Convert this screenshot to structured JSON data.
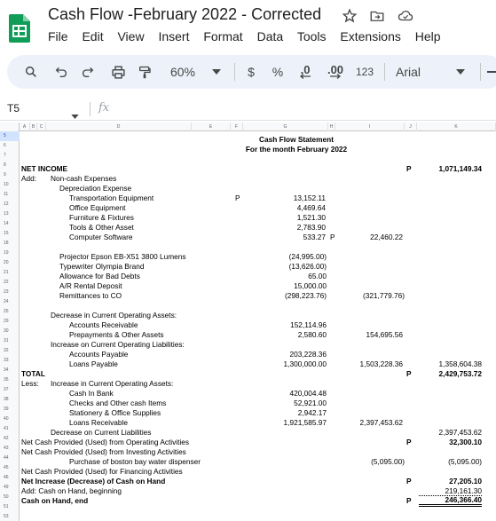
{
  "app": {
    "title": "Cash Flow -February 2022 - Corrected",
    "menu": [
      "File",
      "Edit",
      "View",
      "Insert",
      "Format",
      "Data",
      "Tools",
      "Extensions",
      "Help"
    ]
  },
  "toolbar": {
    "zoom": "60%",
    "currency": "$",
    "percent": "%",
    "dec_decrease": ".0",
    "dec_increase": ".00",
    "number_format": "123",
    "font": "Arial"
  },
  "formula_bar": {
    "cell_ref": "T5",
    "fx": "fx",
    "value": ""
  },
  "columns": [
    "A",
    "B",
    "C",
    "D",
    "E",
    "F",
    "G",
    "H",
    "I",
    "J",
    "K"
  ],
  "rows": [
    "5",
    "6",
    "7",
    "8",
    "9",
    "10",
    "11",
    "12",
    "13",
    "14",
    "15",
    "18",
    "19",
    "20",
    "21",
    "22",
    "23",
    "24",
    "25",
    "29",
    "30",
    "31",
    "32",
    "33",
    "34",
    "35",
    "37",
    "38",
    "39",
    "40",
    "41",
    "42",
    "43",
    "44",
    "45",
    "46",
    "49",
    "50",
    "51",
    "53"
  ],
  "sheet": {
    "title": "Cash Flow Statement",
    "subtitle": "For the month February 2022",
    "net_income_label": "NET INCOME",
    "net_income_p": "P",
    "net_income_value": "1,071,149.34",
    "add_label": "Add:",
    "noncash_label": "Non-cash Expenses",
    "depreciation_label": "Depreciation Expense",
    "dep_items": [
      {
        "label": "Transportation Equipment",
        "p": "P",
        "value": "13,152.11"
      },
      {
        "label": "Office Equipment",
        "p": "",
        "value": "4,469.64"
      },
      {
        "label": "Furniture & Fixtures",
        "p": "",
        "value": "1,521.30"
      },
      {
        "label": "Tools & Other Asset",
        "p": "",
        "value": "2,783.90"
      },
      {
        "label": "Computer Software",
        "p": "",
        "value": "533.27"
      }
    ],
    "dep_total_p": "P",
    "dep_total": "22,460.22",
    "other_items": [
      {
        "label": "Projector Epson EB-X51 3800 Lumens",
        "value": "(24,995.00)"
      },
      {
        "label": "Typewriter Olympia Brand",
        "value": "(13,626.00)"
      },
      {
        "label": "Allowance for Bad Debts",
        "value": "65.00"
      },
      {
        "label": "A/R Rental Deposit",
        "value": "15,000.00"
      },
      {
        "label": "Remittances to CO",
        "value": "(298,223.76)"
      }
    ],
    "other_total": "(321,779.76)",
    "dec_current_assets_label": "Decrease in Current Operating Assets:",
    "dec_items": [
      {
        "label": "Accounts Receivable",
        "value": "152,114.96"
      },
      {
        "label": "Prepayments & Other Assets",
        "value": "2,580.60"
      }
    ],
    "dec_total": "154,695.56",
    "inc_liab_label": "Increase on Current Operating Liabilities:",
    "inc_liab_items": [
      {
        "label": "Accounts Payable",
        "value": "203,228.36"
      },
      {
        "label": "Loans Payable",
        "value": "1,300,000.00"
      }
    ],
    "inc_liab_total": "1,503,228.36",
    "inc_liab_total_k": "1,358,604.38",
    "total_label": "TOTAL",
    "total_p": "P",
    "total_value": "2,429,753.72",
    "less_label": "Less:",
    "inc_current_assets_label": "Increase in Current Operating Assets:",
    "inc_items": [
      {
        "label": "Cash In Bank",
        "value": "420,004.48"
      },
      {
        "label": "Checks and Other cash Items",
        "value": "52,921.00"
      },
      {
        "label": "Stationery & Office Supplies",
        "value": "2,942.17"
      },
      {
        "label": "Loans Receivable",
        "value": "1,921,585.97"
      }
    ],
    "inc_total": "2,397,453.62",
    "dec_liab_label": "Decrease on Current Liabilities",
    "dec_liab_value": "2,397,453.62",
    "op_label": "Net Cash Provided (Used) from Operating Activities",
    "op_p": "P",
    "op_value": "32,300.10",
    "inv_label": "Net Cash Provided (Used) from Investing Activities",
    "purchase_label": "Purchase of boston bay water dispenser",
    "purchase_value": "(5,095.00)",
    "purchase_k": "(5,095.00)",
    "fin_label": "Net Cash Provided (Used) for Financing Activities",
    "net_inc_label": "Net Increase (Decrease) of Cash on Hand",
    "net_inc_p": "P",
    "net_inc_value": "27,205.10",
    "beg_label": "Add: Cash on Hand, beginning",
    "beg_value": "219,161.30",
    "end_label": "Cash on Hand, end",
    "end_p": "P",
    "end_value": "246,366.40"
  }
}
